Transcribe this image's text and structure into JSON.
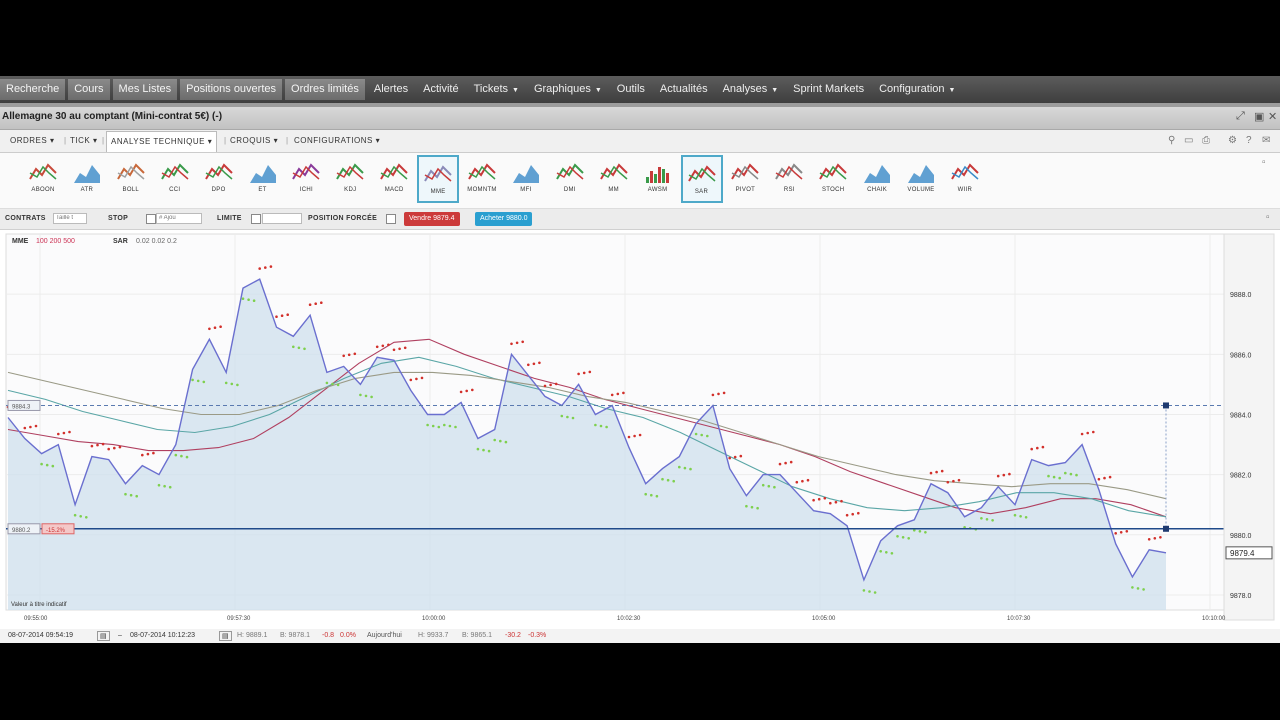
{
  "menubar": {
    "items": [
      {
        "label": "Recherche",
        "style": "light"
      },
      {
        "label": "Cours",
        "style": "light"
      },
      {
        "label": "Mes Listes",
        "style": "light"
      },
      {
        "label": "Positions ouvertes",
        "style": "light"
      },
      {
        "label": "Ordres limités",
        "style": "light"
      },
      {
        "label": "Alertes",
        "style": "dark"
      },
      {
        "label": "Activité",
        "style": "dark"
      },
      {
        "label": "Tickets",
        "style": "dark",
        "caret": true
      },
      {
        "label": "Graphiques",
        "style": "dark",
        "caret": true
      },
      {
        "label": "Outils",
        "style": "dark"
      },
      {
        "label": "Actualités",
        "style": "dark"
      },
      {
        "label": "Analyses",
        "style": "dark",
        "caret": true
      },
      {
        "label": "Sprint Markets",
        "style": "dark"
      },
      {
        "label": "Configuration",
        "style": "dark",
        "caret": true
      }
    ]
  },
  "window": {
    "title": "Allemagne 30 au comptant (Mini-contrat 5€) (-)"
  },
  "tabs": {
    "ordres": "ORDRES",
    "tick": "TICK",
    "analyse": "ANALYSE TECHNIQUE",
    "croquis": "CROQUIS",
    "configurations": "CONFIGURATIONS"
  },
  "indicators": [
    {
      "label": "ABOON",
      "icon": "aroon-icon"
    },
    {
      "label": "ATR",
      "icon": "atr-icon"
    },
    {
      "label": "BOLL",
      "icon": "bollinger-icon"
    },
    {
      "label": "CCI",
      "icon": "cci-icon"
    },
    {
      "label": "DPO",
      "icon": "dpo-icon"
    },
    {
      "label": "ET",
      "icon": "et-icon"
    },
    {
      "label": "ICHI",
      "icon": "ichimoku-icon"
    },
    {
      "label": "KDJ",
      "icon": "kdj-icon"
    },
    {
      "label": "MACD",
      "icon": "macd-icon"
    },
    {
      "label": "MME",
      "icon": "mme-icon",
      "selected": true
    },
    {
      "label": "MOMNTM",
      "icon": "momentum-icon"
    },
    {
      "label": "MFI",
      "icon": "mfi-icon"
    },
    {
      "label": "DMI",
      "icon": "dmi-icon"
    },
    {
      "label": "MM",
      "icon": "mm-icon"
    },
    {
      "label": "AWSM",
      "icon": "awsm-icon"
    },
    {
      "label": "SAR",
      "icon": "sar-icon",
      "selected": true
    },
    {
      "label": "PIVOT",
      "icon": "pivot-icon"
    },
    {
      "label": "RSI",
      "icon": "rsi-icon"
    },
    {
      "label": "STOCH",
      "icon": "stoch-icon"
    },
    {
      "label": "CHAIK",
      "icon": "chaikin-icon"
    },
    {
      "label": "VOLUME",
      "icon": "volume-icon"
    },
    {
      "label": "WIIR",
      "icon": "wiir-icon"
    }
  ],
  "orderbar": {
    "contrats": "CONTRATS",
    "contrats_placeholder": "Taille t",
    "stop": "STOP",
    "stop_placeholder": "# Ajou",
    "limite": "LIMITE",
    "position_forcee": "POSITION FORCÉE",
    "vendre": "Vendre 9879.4",
    "acheter": "Acheter 9880.0",
    "colors": {
      "vendre": "#cc3a3a",
      "acheter": "#2a9fd0"
    }
  },
  "chart_legend": {
    "mme_name": "MME",
    "mme_params": "100  200  500",
    "sar_name": "SAR",
    "sar_params": "0.02  0.02  0.2"
  },
  "chart_data": {
    "type": "line",
    "x": [
      "09:55:00",
      "09:57:30",
      "10:00:00",
      "10:02:30",
      "10:05:00",
      "10:07:30",
      "10:10:00"
    ],
    "ylim": [
      9877.5,
      9890
    ],
    "yticks": [
      "9888.0",
      "9886.0",
      "9884.0",
      "9882.0",
      "9880.0",
      "9878.0"
    ],
    "price_label": "9879.4",
    "left_markers": {
      "upper": "9884.3",
      "lower": "9880.2",
      "lower_change": "-15.2%"
    },
    "value_note": "Valeur à titre indicatif",
    "series": [
      {
        "name": "Price",
        "color": "#6a6fcf",
        "values": [
          9883.9,
          9883.2,
          9882.7,
          9883.0,
          9881.0,
          9882.6,
          9882.5,
          9881.7,
          9882.3,
          9882.0,
          9883.0,
          9885.5,
          9886.5,
          9885.4,
          9888.2,
          9888.5,
          9886.9,
          9886.6,
          9887.3,
          9885.4,
          9885.6,
          9885.0,
          9885.9,
          9885.8,
          9884.8,
          9884.0,
          9884.0,
          9884.4,
          9883.2,
          9883.5,
          9886.0,
          9885.3,
          9884.6,
          9884.3,
          9885.0,
          9884.0,
          9884.3,
          9882.9,
          9881.7,
          9882.2,
          9882.6,
          9883.7,
          9884.3,
          9882.2,
          9881.3,
          9882.0,
          9882.0,
          9881.4,
          9880.8,
          9880.7,
          9880.3,
          9878.5,
          9879.8,
          9880.3,
          9880.5,
          9881.7,
          9881.4,
          9880.6,
          9880.9,
          9881.6,
          9881.0,
          9882.5,
          9882.3,
          9882.4,
          9883.0,
          9881.5,
          9879.7,
          9878.6,
          9879.5,
          9879.4
        ]
      },
      {
        "name": "MME 100",
        "color": "#b04060",
        "values": [
          9883.5,
          9883.3,
          9883.1,
          9883.0,
          9882.8,
          9882.8,
          9882.9,
          9883.2,
          9883.9,
          9884.8,
          9885.7,
          9886.4,
          9886.5,
          9886.0,
          9885.6,
          9885.2,
          9884.9,
          9884.5,
          9884.2,
          9883.9,
          9883.6,
          9883.3,
          9883.0,
          9882.6,
          9882.1,
          9881.7,
          9881.3,
          9880.9,
          9880.7,
          9880.9,
          9881.2,
          9881.2,
          9881.0,
          9880.6
        ]
      },
      {
        "name": "MME 200",
        "color": "#5aa6a6",
        "values": [
          9884.8,
          9884.5,
          9884.1,
          9883.8,
          9883.5,
          9883.4,
          9883.6,
          9884.0,
          9884.6,
          9885.2,
          9885.7,
          9885.9,
          9885.6,
          9885.2,
          9884.9,
          9884.6,
          9884.2,
          9883.9,
          9883.4,
          9882.8,
          9882.2,
          9881.6,
          9881.2,
          9880.9,
          9880.8,
          9880.9,
          9881.1,
          9881.4,
          9881.4,
          9881.2,
          9880.8,
          9880.6
        ]
      },
      {
        "name": "MME 500",
        "color": "#9a9a86",
        "values": [
          9885.4,
          9885.1,
          9884.8,
          9884.5,
          9884.2,
          9884.0,
          9884.0,
          9884.3,
          9884.8,
          9885.2,
          9885.4,
          9885.4,
          9885.3,
          9885.1,
          9884.9,
          9884.6,
          9884.4,
          9884.1,
          9883.8,
          9883.4,
          9883.0,
          9882.6,
          9882.3,
          9882.0,
          9881.8,
          9881.7,
          9881.6,
          9881.7,
          9881.7,
          9881.5,
          9881.2
        ]
      }
    ]
  },
  "statusbar": {
    "start": "08-07-2014 09:54:19",
    "end": "08-07-2014 10:12:23",
    "h": "H: 9889.1",
    "b": "B: 9878.1",
    "chg": "-0.8",
    "chg_pct": "0.0%",
    "today": "Aujourd'hui",
    "h2": "H: 9933.7",
    "b2": "B: 9865.1",
    "chg2": "-30.2",
    "chg2_pct": "-0.3%"
  }
}
